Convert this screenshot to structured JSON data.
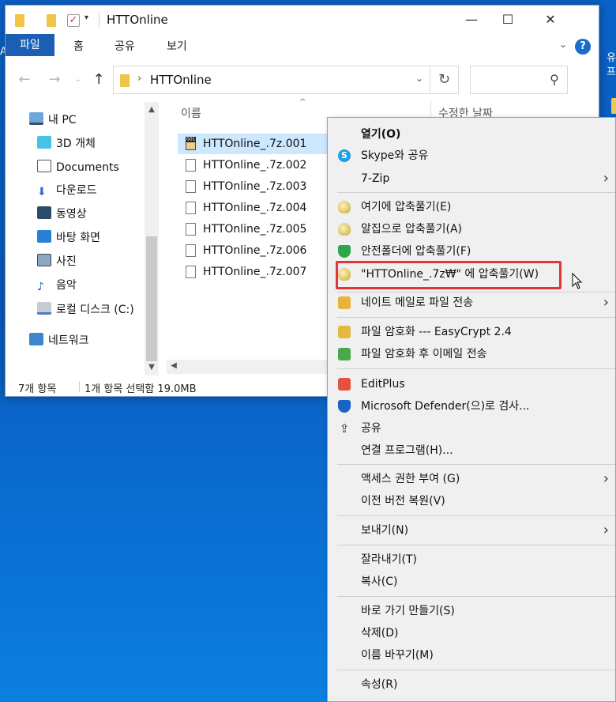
{
  "window": {
    "title": "HTTOnline",
    "minimize_glyph": "—",
    "maximize_glyph": "☐",
    "close_glyph": "✕"
  },
  "ribbon": {
    "tabs": [
      "파일",
      "홈",
      "공유",
      "보기"
    ],
    "help_glyph": "?"
  },
  "address": {
    "path": "HTTOnline"
  },
  "navigation": {
    "items": [
      {
        "label": "내 PC",
        "icon": "pc-icon"
      },
      {
        "label": "3D 개체",
        "icon": "3d-objects-icon"
      },
      {
        "label": "Documents",
        "icon": "documents-icon"
      },
      {
        "label": "다운로드",
        "icon": "downloads-icon"
      },
      {
        "label": "동영상",
        "icon": "videos-icon"
      },
      {
        "label": "바탕 화면",
        "icon": "desktop-icon"
      },
      {
        "label": "사진",
        "icon": "pictures-icon"
      },
      {
        "label": "음악",
        "icon": "music-icon"
      },
      {
        "label": "로컬 디스크 (C:)",
        "icon": "local-disk-icon"
      },
      {
        "label": "네트워크",
        "icon": "network-icon"
      }
    ]
  },
  "columns": {
    "name": "이름",
    "date": "수정한 날짜"
  },
  "files": [
    {
      "name": "HTTOnline_.7z.001",
      "selected": true
    },
    {
      "name": "HTTOnline_.7z.002",
      "selected": false
    },
    {
      "name": "HTTOnline_.7z.003",
      "selected": false
    },
    {
      "name": "HTTOnline_.7z.004",
      "selected": false
    },
    {
      "name": "HTTOnline_.7z.005",
      "selected": false
    },
    {
      "name": "HTTOnline_.7z.006",
      "selected": false
    },
    {
      "name": "HTTOnline_.7z.007",
      "selected": false
    }
  ],
  "status": {
    "count": "7개 항목",
    "selection": "1개 항목 선택함 19.0MB"
  },
  "context_menu": {
    "items": [
      {
        "label": "열기(O)",
        "icon": "",
        "bold": true
      },
      {
        "label": "Skype와 공유",
        "icon": "skype-icon"
      },
      {
        "label": "7-Zip",
        "icon": "",
        "submenu": true
      },
      {
        "label": "여기에 압축풀기(E)",
        "icon": "bandizip-icon"
      },
      {
        "label": "알집으로 압축풀기(A)",
        "icon": "bandizip-icon"
      },
      {
        "label": "안전폴더에 압축풀기(F)",
        "icon": "shield-icon"
      },
      {
        "label": "\"HTTOnline_.7z₩\" 에 압축풀기(W)",
        "icon": "bandizip-icon"
      },
      {
        "label": "네이트 메일로 파일 전송",
        "icon": "nate-mail-icon",
        "submenu": true
      },
      {
        "label": "파일 암호화 --- EasyCrypt 2.4",
        "icon": "lock-icon"
      },
      {
        "label": "파일 암호화 후 이메일 전송",
        "icon": "send-mail-icon"
      },
      {
        "label": "EditPlus",
        "icon": "editplus-icon"
      },
      {
        "label": "Microsoft Defender(으)로 검사...",
        "icon": "defender-icon"
      },
      {
        "label": "공유",
        "icon": "share-icon"
      },
      {
        "label": "연결 프로그램(H)...",
        "icon": ""
      },
      {
        "label": "액세스 권한 부여 (G)",
        "icon": "",
        "submenu": true
      },
      {
        "label": "이전 버전 복원(V)",
        "icon": ""
      },
      {
        "label": "보내기(N)",
        "icon": "",
        "submenu": true
      },
      {
        "label": "잘라내기(T)",
        "icon": ""
      },
      {
        "label": "복사(C)",
        "icon": ""
      },
      {
        "label": "바로 가기 만들기(S)",
        "icon": ""
      },
      {
        "label": "삭제(D)",
        "icon": ""
      },
      {
        "label": "이름 바꾸기(M)",
        "icon": ""
      },
      {
        "label": "속성(R)",
        "icon": ""
      }
    ],
    "highlighted_index": 6,
    "highlight_color": "#e3343a"
  },
  "colors": {
    "accent": "#1a5fb4",
    "selection": "#cce8ff",
    "desktop": "#0b5cbd"
  }
}
